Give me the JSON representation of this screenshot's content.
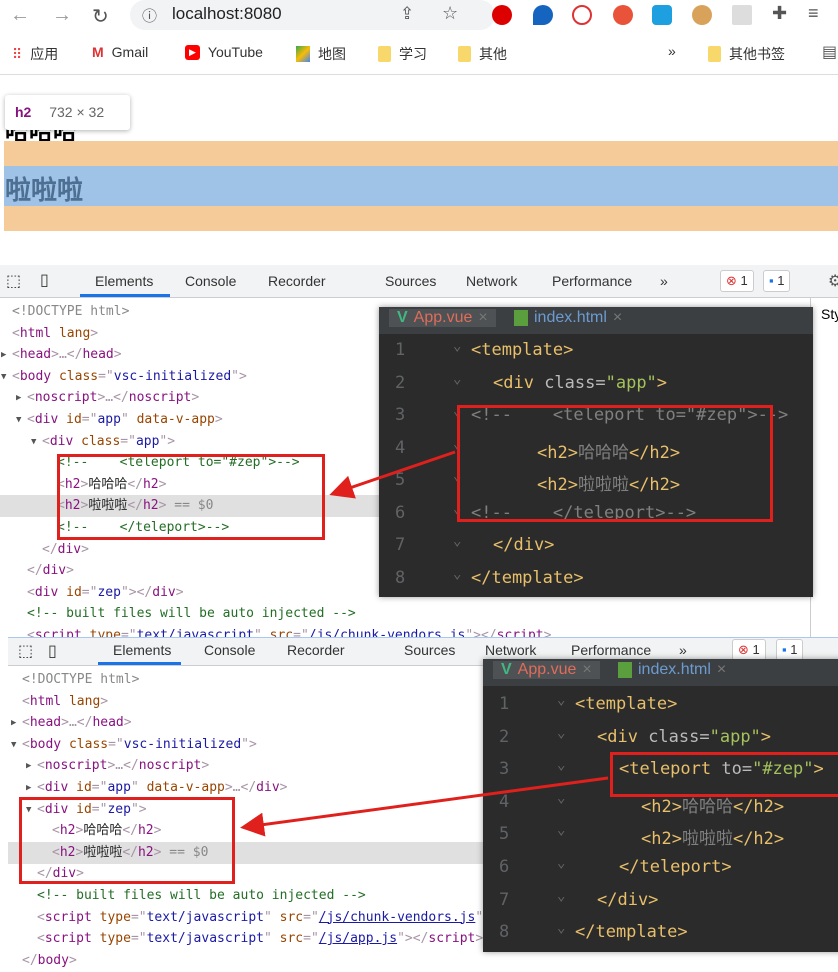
{
  "browser": {
    "url": "localhost:8080",
    "bookmarks": [
      {
        "label": "应用",
        "icon": "apps-grid-icon"
      },
      {
        "label": "Gmail",
        "icon": "gmail-icon"
      },
      {
        "label": "YouTube",
        "icon": "youtube-icon"
      },
      {
        "label": "地图",
        "icon": "maps-icon"
      },
      {
        "label": "学习",
        "icon": "folder-icon"
      },
      {
        "label": "其他",
        "icon": "folder-icon"
      }
    ],
    "more_bookmarks": "»",
    "other_bookmarks": "其他书签"
  },
  "page": {
    "tooltip_tag": "h2",
    "tooltip_size": "732 × 32",
    "h2_first": "哈哈哈",
    "h2_second": "啦啦啦"
  },
  "devtools": {
    "tabs": [
      "Elements",
      "Console",
      "Recorder",
      "Sources",
      "Network",
      "Performance"
    ],
    "more": "»",
    "errors": "1",
    "messages": "1",
    "styles_tab": "Sty"
  },
  "panel1": {
    "lines": [
      {
        "indent": 0,
        "tokens": [
          [
            "<!DOCTYPE html>",
            "dim"
          ]
        ]
      },
      {
        "indent": 0,
        "tokens": [
          [
            "<",
            "punct"
          ],
          [
            "html",
            "tag"
          ],
          [
            " lang",
            "attr"
          ],
          [
            ">",
            "punct"
          ]
        ]
      },
      {
        "indent": 0,
        "arrow": "▶",
        "tokens": [
          [
            "<",
            "punct"
          ],
          [
            "head",
            "tag"
          ],
          [
            ">…</",
            "punct"
          ],
          [
            "head",
            "tag"
          ],
          [
            ">",
            "punct"
          ]
        ]
      },
      {
        "indent": 0,
        "arrow": "▼",
        "tokens": [
          [
            "<",
            "punct"
          ],
          [
            "body",
            "tag"
          ],
          [
            " class",
            "attr"
          ],
          [
            "=\"",
            "punct"
          ],
          [
            "vsc-initialized",
            "val"
          ],
          [
            "\">",
            "punct"
          ]
        ]
      },
      {
        "indent": 1,
        "arrow": "▶",
        "tokens": [
          [
            "<",
            "punct"
          ],
          [
            "noscript",
            "tag"
          ],
          [
            ">…</",
            "punct"
          ],
          [
            "noscript",
            "tag"
          ],
          [
            ">",
            "punct"
          ]
        ]
      },
      {
        "indent": 1,
        "arrow": "▼",
        "tokens": [
          [
            "<",
            "punct"
          ],
          [
            "div",
            "tag"
          ],
          [
            " id",
            "attr"
          ],
          [
            "=\"",
            "punct"
          ],
          [
            "app",
            "val"
          ],
          [
            "\"",
            "punct"
          ],
          [
            " data-v-app",
            "attr"
          ],
          [
            ">",
            "punct"
          ]
        ]
      },
      {
        "indent": 2,
        "arrow": "▼",
        "tokens": [
          [
            "<",
            "punct"
          ],
          [
            "div",
            "tag"
          ],
          [
            " class",
            "attr"
          ],
          [
            "=\"",
            "punct"
          ],
          [
            "app",
            "val"
          ],
          [
            "\">",
            "punct"
          ]
        ]
      },
      {
        "indent": 3,
        "tokens": [
          [
            "<!--    <teleport to=\"#zep\">-->",
            "com"
          ]
        ]
      },
      {
        "indent": 3,
        "tokens": [
          [
            "<",
            "punct"
          ],
          [
            "h2",
            "tag"
          ],
          [
            ">",
            "punct"
          ],
          [
            "哈哈哈",
            "text"
          ],
          [
            "</",
            "punct"
          ],
          [
            "h2",
            "tag"
          ],
          [
            ">",
            "punct"
          ]
        ]
      },
      {
        "indent": 3,
        "selected": true,
        "tokens": [
          [
            "<",
            "punct"
          ],
          [
            "h2",
            "tag"
          ],
          [
            ">",
            "punct"
          ],
          [
            "啦啦啦",
            "text"
          ],
          [
            "</",
            "punct"
          ],
          [
            "h2",
            "tag"
          ],
          [
            ">",
            "punct"
          ],
          [
            " == $0",
            "dim"
          ]
        ]
      },
      {
        "indent": 3,
        "tokens": [
          [
            "<!--    </teleport>-->",
            "com"
          ]
        ]
      },
      {
        "indent": 2,
        "tokens": [
          [
            "</",
            "punct"
          ],
          [
            "div",
            "tag"
          ],
          [
            ">",
            "punct"
          ]
        ]
      },
      {
        "indent": 1,
        "tokens": [
          [
            "</",
            "punct"
          ],
          [
            "div",
            "tag"
          ],
          [
            ">",
            "punct"
          ]
        ]
      },
      {
        "indent": 1,
        "tokens": [
          [
            "<",
            "punct"
          ],
          [
            "div",
            "tag"
          ],
          [
            " id",
            "attr"
          ],
          [
            "=\"",
            "punct"
          ],
          [
            "zep",
            "val"
          ],
          [
            "\"></",
            "punct"
          ],
          [
            "div",
            "tag"
          ],
          [
            ">",
            "punct"
          ]
        ]
      },
      {
        "indent": 1,
        "tokens": [
          [
            "<!-- built files will be auto injected -->",
            "com"
          ]
        ]
      },
      {
        "indent": 1,
        "tokens": [
          [
            "<",
            "punct"
          ],
          [
            "script",
            "tag"
          ],
          [
            " type",
            "attr"
          ],
          [
            "=\"",
            "punct"
          ],
          [
            "text/javascript",
            "val"
          ],
          [
            "\"",
            "punct"
          ],
          [
            " src",
            "attr"
          ],
          [
            "=\"",
            "punct"
          ],
          [
            "/js/chunk-vendors.js",
            "link"
          ],
          [
            "\"></",
            "punct"
          ],
          [
            "script",
            "tag"
          ],
          [
            ">",
            "punct"
          ]
        ]
      }
    ]
  },
  "panel2": {
    "lines": [
      {
        "indent": 0,
        "tokens": [
          [
            "<!DOCTYPE html>",
            "dim"
          ]
        ]
      },
      {
        "indent": 0,
        "tokens": [
          [
            "<",
            "punct"
          ],
          [
            "html",
            "tag"
          ],
          [
            " lang",
            "attr"
          ],
          [
            ">",
            "punct"
          ]
        ]
      },
      {
        "indent": 0,
        "arrow": "▶",
        "tokens": [
          [
            "<",
            "punct"
          ],
          [
            "head",
            "tag"
          ],
          [
            ">…</",
            "punct"
          ],
          [
            "head",
            "tag"
          ],
          [
            ">",
            "punct"
          ]
        ]
      },
      {
        "indent": 0,
        "arrow": "▼",
        "tokens": [
          [
            "<",
            "punct"
          ],
          [
            "body",
            "tag"
          ],
          [
            " class",
            "attr"
          ],
          [
            "=\"",
            "punct"
          ],
          [
            "vsc-initialized",
            "val"
          ],
          [
            "\">",
            "punct"
          ]
        ]
      },
      {
        "indent": 1,
        "arrow": "▶",
        "tokens": [
          [
            "<",
            "punct"
          ],
          [
            "noscript",
            "tag"
          ],
          [
            ">…</",
            "punct"
          ],
          [
            "noscript",
            "tag"
          ],
          [
            ">",
            "punct"
          ]
        ]
      },
      {
        "indent": 1,
        "arrow": "▶",
        "tokens": [
          [
            "<",
            "punct"
          ],
          [
            "div",
            "tag"
          ],
          [
            " id",
            "attr"
          ],
          [
            "=\"",
            "punct"
          ],
          [
            "app",
            "val"
          ],
          [
            "\"",
            "punct"
          ],
          [
            " data-v-app",
            "attr"
          ],
          [
            ">…</",
            "punct"
          ],
          [
            "div",
            "tag"
          ],
          [
            ">",
            "punct"
          ]
        ]
      },
      {
        "indent": 1,
        "arrow": "▼",
        "tokens": [
          [
            "<",
            "punct"
          ],
          [
            "div",
            "tag"
          ],
          [
            " id",
            "attr"
          ],
          [
            "=\"",
            "punct"
          ],
          [
            "zep",
            "val"
          ],
          [
            "\">",
            "punct"
          ]
        ]
      },
      {
        "indent": 2,
        "tokens": [
          [
            "<",
            "punct"
          ],
          [
            "h2",
            "tag"
          ],
          [
            ">",
            "punct"
          ],
          [
            "哈哈哈",
            "text"
          ],
          [
            "</",
            "punct"
          ],
          [
            "h2",
            "tag"
          ],
          [
            ">",
            "punct"
          ]
        ]
      },
      {
        "indent": 2,
        "selected": true,
        "tokens": [
          [
            "<",
            "punct"
          ],
          [
            "h2",
            "tag"
          ],
          [
            ">",
            "punct"
          ],
          [
            "啦啦啦",
            "text"
          ],
          [
            "</",
            "punct"
          ],
          [
            "h2",
            "tag"
          ],
          [
            ">",
            "punct"
          ],
          [
            " == $0",
            "dim"
          ]
        ]
      },
      {
        "indent": 1,
        "tokens": [
          [
            "</",
            "punct"
          ],
          [
            "div",
            "tag"
          ],
          [
            ">",
            "punct"
          ]
        ]
      },
      {
        "indent": 1,
        "tokens": [
          [
            "<!-- built files will be auto injected -->",
            "com"
          ]
        ]
      },
      {
        "indent": 1,
        "tokens": [
          [
            "<",
            "punct"
          ],
          [
            "script",
            "tag"
          ],
          [
            " type",
            "attr"
          ],
          [
            "=\"",
            "punct"
          ],
          [
            "text/javascript",
            "val"
          ],
          [
            "\"",
            "punct"
          ],
          [
            " src",
            "attr"
          ],
          [
            "=\"",
            "punct"
          ],
          [
            "/js/chunk-vendors.js",
            "link"
          ],
          [
            "\"></",
            "punct"
          ],
          [
            "script",
            "tag"
          ],
          [
            ">",
            "punct"
          ]
        ]
      },
      {
        "indent": 1,
        "tokens": [
          [
            "<",
            "punct"
          ],
          [
            "script",
            "tag"
          ],
          [
            " type",
            "attr"
          ],
          [
            "=\"",
            "punct"
          ],
          [
            "text/javascript",
            "val"
          ],
          [
            "\"",
            "punct"
          ],
          [
            " src",
            "attr"
          ],
          [
            "=\"",
            "punct"
          ],
          [
            "/js/app.js",
            "link"
          ],
          [
            "\"></",
            "punct"
          ],
          [
            "script",
            "tag"
          ],
          [
            ">",
            "punct"
          ]
        ]
      },
      {
        "indent": 0,
        "tokens": [
          [
            "</",
            "punct"
          ],
          [
            "body",
            "tag"
          ],
          [
            ">",
            "punct"
          ]
        ]
      }
    ]
  },
  "editor1": {
    "tabs": [
      "App.vue",
      "index.html"
    ],
    "lines": [
      {
        "n": "1",
        "indent": 0,
        "tokens": [
          [
            "<template>",
            "tag"
          ]
        ]
      },
      {
        "n": "2",
        "indent": 1,
        "tokens": [
          [
            "<div",
            "tag"
          ],
          [
            " class=",
            "attr"
          ],
          [
            "\"app\"",
            "val"
          ],
          [
            ">",
            "tag"
          ]
        ]
      },
      {
        "n": "3",
        "indent": 0,
        "tokens": [
          [
            "<!--    <teleport to=\"#zep\">-->",
            "com"
          ]
        ]
      },
      {
        "n": "4",
        "indent": 3,
        "tokens": [
          [
            "<h2>",
            "tag"
          ],
          [
            "哈哈哈",
            "com"
          ],
          [
            "</h2>",
            "tag"
          ]
        ]
      },
      {
        "n": "5",
        "indent": 3,
        "tokens": [
          [
            "<h2>",
            "tag"
          ],
          [
            "啦啦啦",
            "com"
          ],
          [
            "</h2>",
            "tag"
          ]
        ]
      },
      {
        "n": "6",
        "indent": 0,
        "tokens": [
          [
            "<!--    </teleport>-->",
            "com"
          ]
        ]
      },
      {
        "n": "7",
        "indent": 1,
        "tokens": [
          [
            "</div>",
            "tag"
          ]
        ]
      },
      {
        "n": "8",
        "indent": 0,
        "tokens": [
          [
            "</template>",
            "tag"
          ]
        ]
      }
    ]
  },
  "editor2": {
    "tabs": [
      "App.vue",
      "index.html"
    ],
    "lines": [
      {
        "n": "1",
        "indent": 0,
        "tokens": [
          [
            "<template>",
            "tag"
          ]
        ]
      },
      {
        "n": "2",
        "indent": 1,
        "tokens": [
          [
            "<div",
            "tag"
          ],
          [
            " class=",
            "attr"
          ],
          [
            "\"app\"",
            "val"
          ],
          [
            ">",
            "tag"
          ]
        ]
      },
      {
        "n": "3",
        "indent": 2,
        "tokens": [
          [
            "<teleport",
            "tag"
          ],
          [
            " to=",
            "attr"
          ],
          [
            "\"#zep\"",
            "val"
          ],
          [
            ">",
            "tag"
          ]
        ]
      },
      {
        "n": "4",
        "indent": 3,
        "tokens": [
          [
            "<h2>",
            "tag"
          ],
          [
            "哈哈哈",
            "com"
          ],
          [
            "</h2>",
            "tag"
          ]
        ]
      },
      {
        "n": "5",
        "indent": 3,
        "tokens": [
          [
            "<h2>",
            "tag"
          ],
          [
            "啦啦啦",
            "com"
          ],
          [
            "</h2>",
            "tag"
          ]
        ]
      },
      {
        "n": "6",
        "indent": 2,
        "tokens": [
          [
            "</teleport>",
            "tag"
          ]
        ]
      },
      {
        "n": "7",
        "indent": 1,
        "tokens": [
          [
            "</div>",
            "tag"
          ]
        ]
      },
      {
        "n": "8",
        "indent": 0,
        "tokens": [
          [
            "</template>",
            "tag"
          ]
        ]
      }
    ]
  },
  "colors": {
    "annotation": "#e0201c",
    "margin_overlay": "#f6cb9a",
    "content_overlay": "#9fc3e7",
    "devtools_accent": "#1a73e8",
    "editor_bg": "#2b2b2b"
  }
}
